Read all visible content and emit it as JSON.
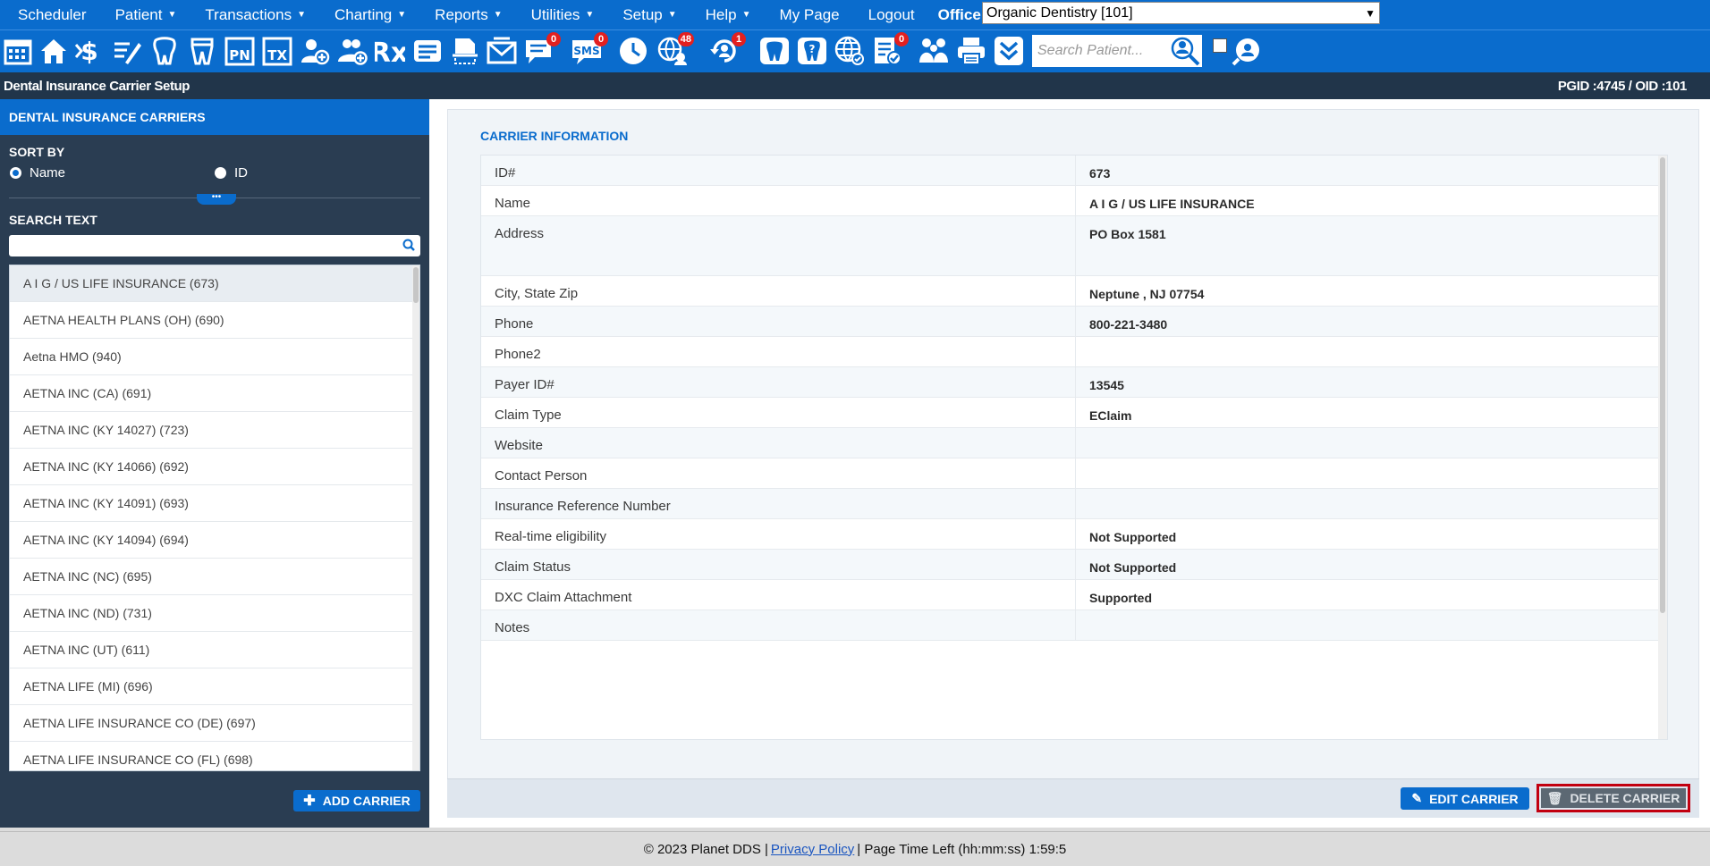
{
  "menu": {
    "items": [
      {
        "label": "Scheduler",
        "caret": false
      },
      {
        "label": "Patient",
        "caret": true
      },
      {
        "label": "Transactions",
        "caret": true
      },
      {
        "label": "Charting",
        "caret": true
      },
      {
        "label": "Reports",
        "caret": true
      },
      {
        "label": "Utilities",
        "caret": true
      },
      {
        "label": "Setup",
        "caret": true
      },
      {
        "label": "Help",
        "caret": true
      },
      {
        "label": "My Page",
        "caret": false
      },
      {
        "label": "Logout",
        "caret": false
      }
    ],
    "office_label": "Office",
    "office_value": "Organic Dentistry [101]"
  },
  "toolbar": {
    "sms_badge": "0",
    "messages_badge": "0",
    "online_badge": "48",
    "recall_badge": "1",
    "forms_badge": "0",
    "pn_label": "PN",
    "tx_label": "TX",
    "rx_label": "Rx",
    "sms_label": "SMS",
    "search_placeholder": "Search Patient..."
  },
  "page": {
    "title": "Dental Insurance Carrier Setup",
    "ids": "PGID :4745  /  OID :101"
  },
  "left": {
    "title": "DENTAL INSURANCE CARRIERS",
    "sort_by": "SORT BY",
    "sort_name": "Name",
    "sort_id": "ID",
    "search_label": "SEARCH TEXT",
    "carriers": [
      "A I G / US LIFE INSURANCE (673)",
      "AETNA HEALTH PLANS (OH) (690)",
      "Aetna HMO (940)",
      "AETNA INC (CA) (691)",
      "AETNA INC (KY 14027) (723)",
      "AETNA INC (KY 14066) (692)",
      "AETNA INC (KY 14091) (693)",
      "AETNA INC (KY 14094) (694)",
      "AETNA INC (NC) (695)",
      "AETNA INC (ND) (731)",
      "AETNA INC (UT) (611)",
      "AETNA LIFE (MI) (696)",
      "AETNA LIFE INSURANCE CO (DE) (697)",
      "AETNA LIFE INSURANCE CO (FL) (698)"
    ],
    "add_carrier": "ADD CARRIER"
  },
  "carrier": {
    "header": "CARRIER INFORMATION",
    "rows": [
      {
        "key": "ID#",
        "value": "673"
      },
      {
        "key": "Name",
        "value": "A I G / US LIFE INSURANCE"
      },
      {
        "key": "Address",
        "value": "PO Box 1581"
      },
      {
        "key": "City, State Zip",
        "value": "Neptune , NJ 07754"
      },
      {
        "key": "Phone",
        "value": "800-221-3480"
      },
      {
        "key": "Phone2",
        "value": ""
      },
      {
        "key": "Payer ID#",
        "value": "13545"
      },
      {
        "key": "Claim Type",
        "value": "EClaim"
      },
      {
        "key": "Website",
        "value": ""
      },
      {
        "key": "Contact Person",
        "value": ""
      },
      {
        "key": "Insurance Reference Number",
        "value": ""
      },
      {
        "key": "Real-time eligibility",
        "value": "Not Supported"
      },
      {
        "key": "Claim Status",
        "value": "Not Supported"
      },
      {
        "key": "DXC Claim Attachment",
        "value": "Supported"
      },
      {
        "key": "Notes",
        "value": ""
      }
    ],
    "edit_label": "EDIT CARRIER",
    "delete_label": "DELETE CARRIER"
  },
  "footer": {
    "copyright": "© 2023 Planet DDS |",
    "privacy": "Privacy Policy",
    "time_left": "|  Page Time Left (hh:mm:ss) 1:59:5"
  }
}
